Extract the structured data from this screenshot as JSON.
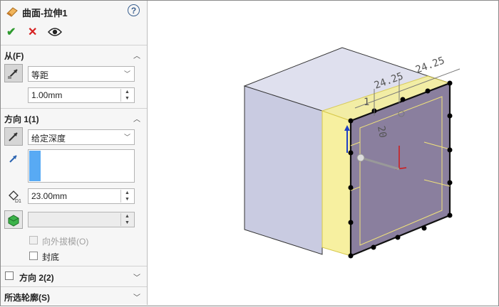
{
  "header": {
    "title": "曲面-拉伸1",
    "help": "?"
  },
  "actions": {
    "ok": "✔",
    "cancel": "✕"
  },
  "from": {
    "title": "从(F)",
    "condition": "等距",
    "offset": "1.00mm"
  },
  "direction1": {
    "title": "方向 1(1)",
    "end_condition": "给定深度",
    "depth": "23.00mm",
    "depth_icon_label": "D1",
    "draft_outward": "向外拔模(O)",
    "cap_end": "封底"
  },
  "direction2": {
    "title": "方向 2(2)"
  },
  "contours": {
    "title": "所选轮廓(S)"
  },
  "viewport": {
    "dim_a": "24.25",
    "dim_b": "24.25",
    "dim_c": "20",
    "dim_d": "1"
  },
  "colors": {
    "accent_blue": "#58aaf4",
    "face_purple": "#8a7f9e",
    "highlight_yellow": "#f7f0a0"
  }
}
